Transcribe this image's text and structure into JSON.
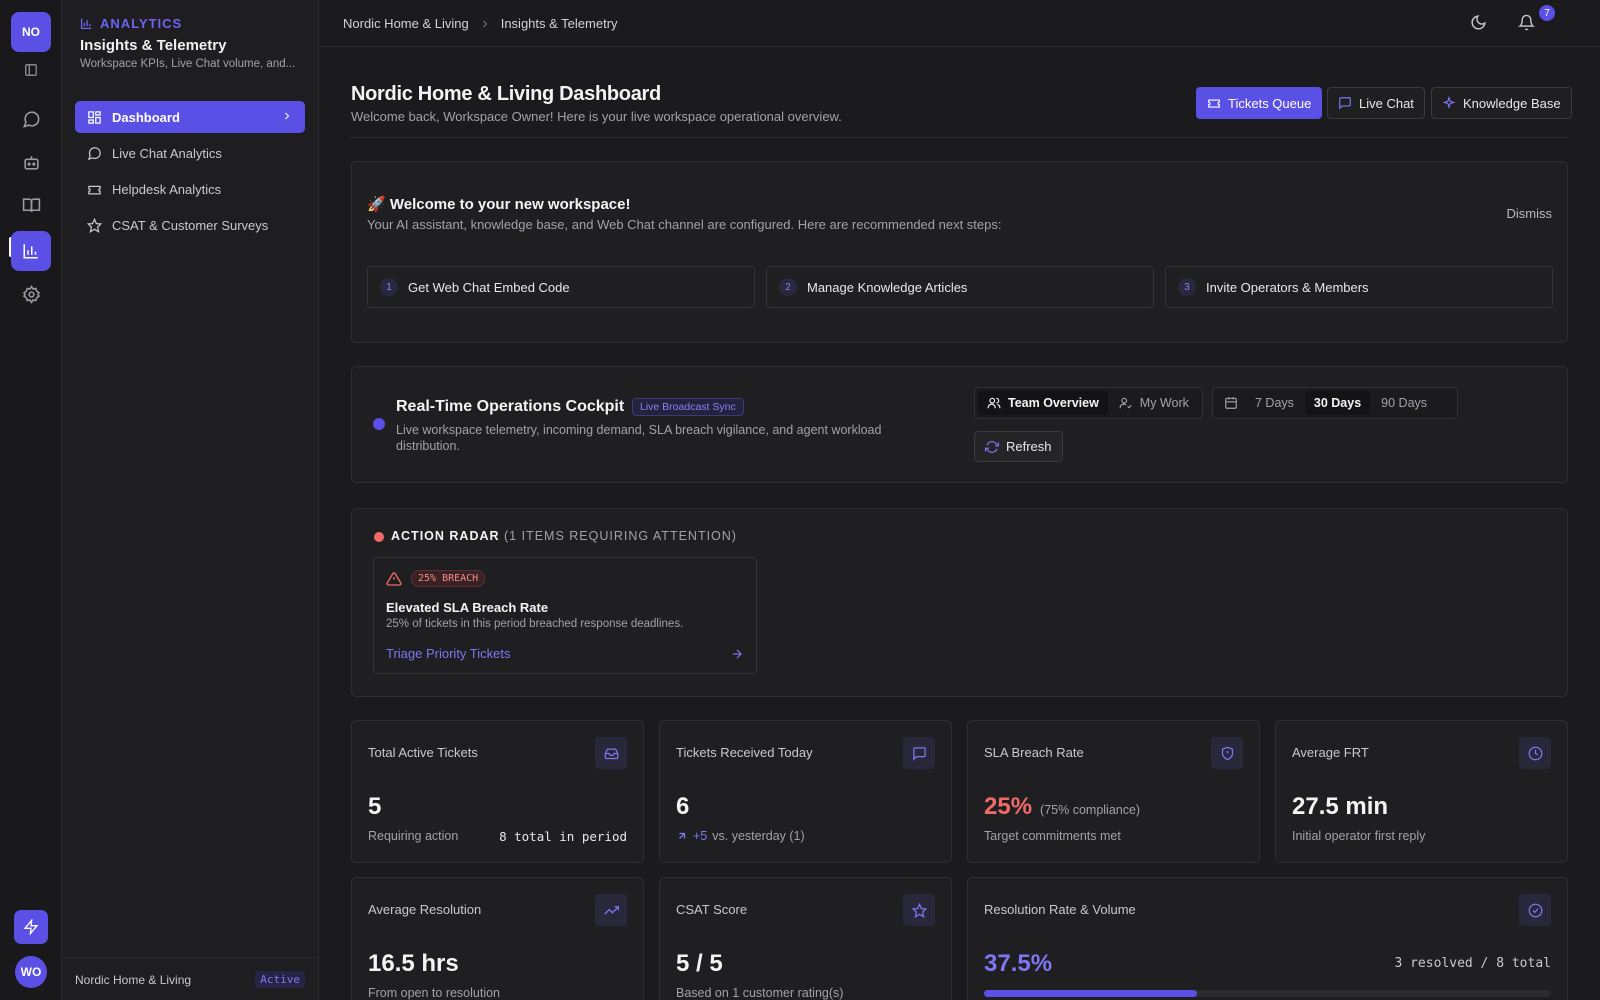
{
  "rail": {
    "logo": "NO",
    "avatar": "WO",
    "icons": [
      "sidebar-toggle-icon",
      "chat-icon",
      "bot-icon",
      "book-icon",
      "analytics-icon",
      "settings-icon",
      "bolt-icon"
    ]
  },
  "panel": {
    "eyebrow": "ANALYTICS",
    "title": "Insights & Telemetry",
    "subtitle": "Workspace KPIs, Live Chat volume, and...",
    "nav": [
      {
        "label": "Dashboard",
        "active": true
      },
      {
        "label": "Live Chat Analytics"
      },
      {
        "label": "Helpdesk Analytics"
      },
      {
        "label": "CSAT & Customer Surveys"
      }
    ],
    "footer": {
      "workspace": "Nordic Home & Living",
      "status": "Active"
    }
  },
  "topbar": {
    "breadcrumb": [
      "Nordic Home & Living",
      "Insights & Telemetry"
    ],
    "notifications": "7"
  },
  "header": {
    "title": "Nordic Home & Living Dashboard",
    "subtitle": "Welcome back, Workspace Owner! Here is your live workspace operational overview.",
    "buttons": {
      "tickets": "Tickets Queue",
      "chat": "Live Chat",
      "kb": "Knowledge Base"
    }
  },
  "welcome": {
    "title": "🚀 Welcome to your new workspace!",
    "subtitle": "Your AI assistant, knowledge base, and Web Chat channel are configured. Here are recommended next steps:",
    "dismiss": "Dismiss",
    "steps": [
      {
        "num": "1",
        "label": "Get Web Chat Embed Code"
      },
      {
        "num": "2",
        "label": "Manage Knowledge Articles"
      },
      {
        "num": "3",
        "label": "Invite Operators & Members"
      }
    ]
  },
  "cockpit": {
    "title": "Real-Time Operations Cockpit",
    "badge": "Live Broadcast Sync",
    "subtitle": "Live workspace telemetry, incoming demand, SLA breach vigilance, and agent workload distribution.",
    "views": [
      "Team Overview",
      "My Work"
    ],
    "selected_view": "Team Overview",
    "ranges": [
      "7 Days",
      "30 Days",
      "90 Days"
    ],
    "selected_range": "30 Days",
    "refresh": "Refresh"
  },
  "radar": {
    "title": "ACTION RADAR",
    "count": "(1 ITEMS REQUIRING ATTENTION)",
    "alert": {
      "tag": "25% BREACH",
      "title": "Elevated SLA Breach Rate",
      "body": "25% of tickets in this period breached response deadlines.",
      "link": "Triage Priority Tickets"
    }
  },
  "kpis": [
    {
      "label": "Total Active Tickets",
      "value": "5",
      "sub": "Requiring action",
      "right": "8 total in period",
      "icon": "inbox-icon"
    },
    {
      "label": "Tickets Received Today",
      "value": "6",
      "delta": "+5",
      "sub": "vs. yesterday (1)",
      "icon": "message-icon"
    },
    {
      "label": "SLA Breach Rate",
      "value": "25%",
      "note": "(75% compliance)",
      "sub": "Target commitments met",
      "icon": "shield-icon",
      "accent": "#f06a6a"
    },
    {
      "label": "Average FRT",
      "value": "27.5 min",
      "sub": "Initial operator first reply",
      "icon": "clock-icon"
    },
    {
      "label": "Average Resolution",
      "value": "16.5 hrs",
      "sub": "From open to resolution",
      "icon": "trend-up-icon"
    },
    {
      "label": "CSAT Score",
      "value": "5 / 5",
      "sub": "Based on 1 customer rating(s)",
      "icon": "star-icon"
    },
    {
      "label": "Resolution Rate & Volume",
      "value": "37.5%",
      "right": "3 resolved / 8 total",
      "progress": 0.375,
      "icon": "check-circle-icon",
      "accent": "#7e76f2"
    }
  ]
}
